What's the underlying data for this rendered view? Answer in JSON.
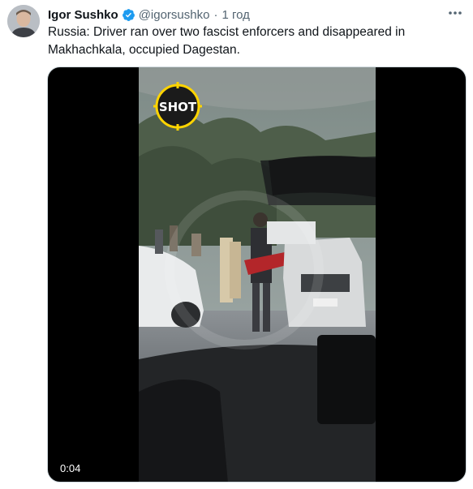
{
  "author": {
    "name": "Igor Sushko",
    "handle": "@igorsushko",
    "separator": "·",
    "time": "1 год",
    "verified": true,
    "verified_color": "#1d9bf0"
  },
  "more_icon": "more-horizontal-icon",
  "text": "Russia: Driver ran over two fascist enforcers and disappeared in Makhachkala, occupied Dagestan.",
  "media": {
    "type": "video",
    "watermark": "SHOT",
    "timecode": "0:04",
    "watermark_color": "#ffd400"
  }
}
